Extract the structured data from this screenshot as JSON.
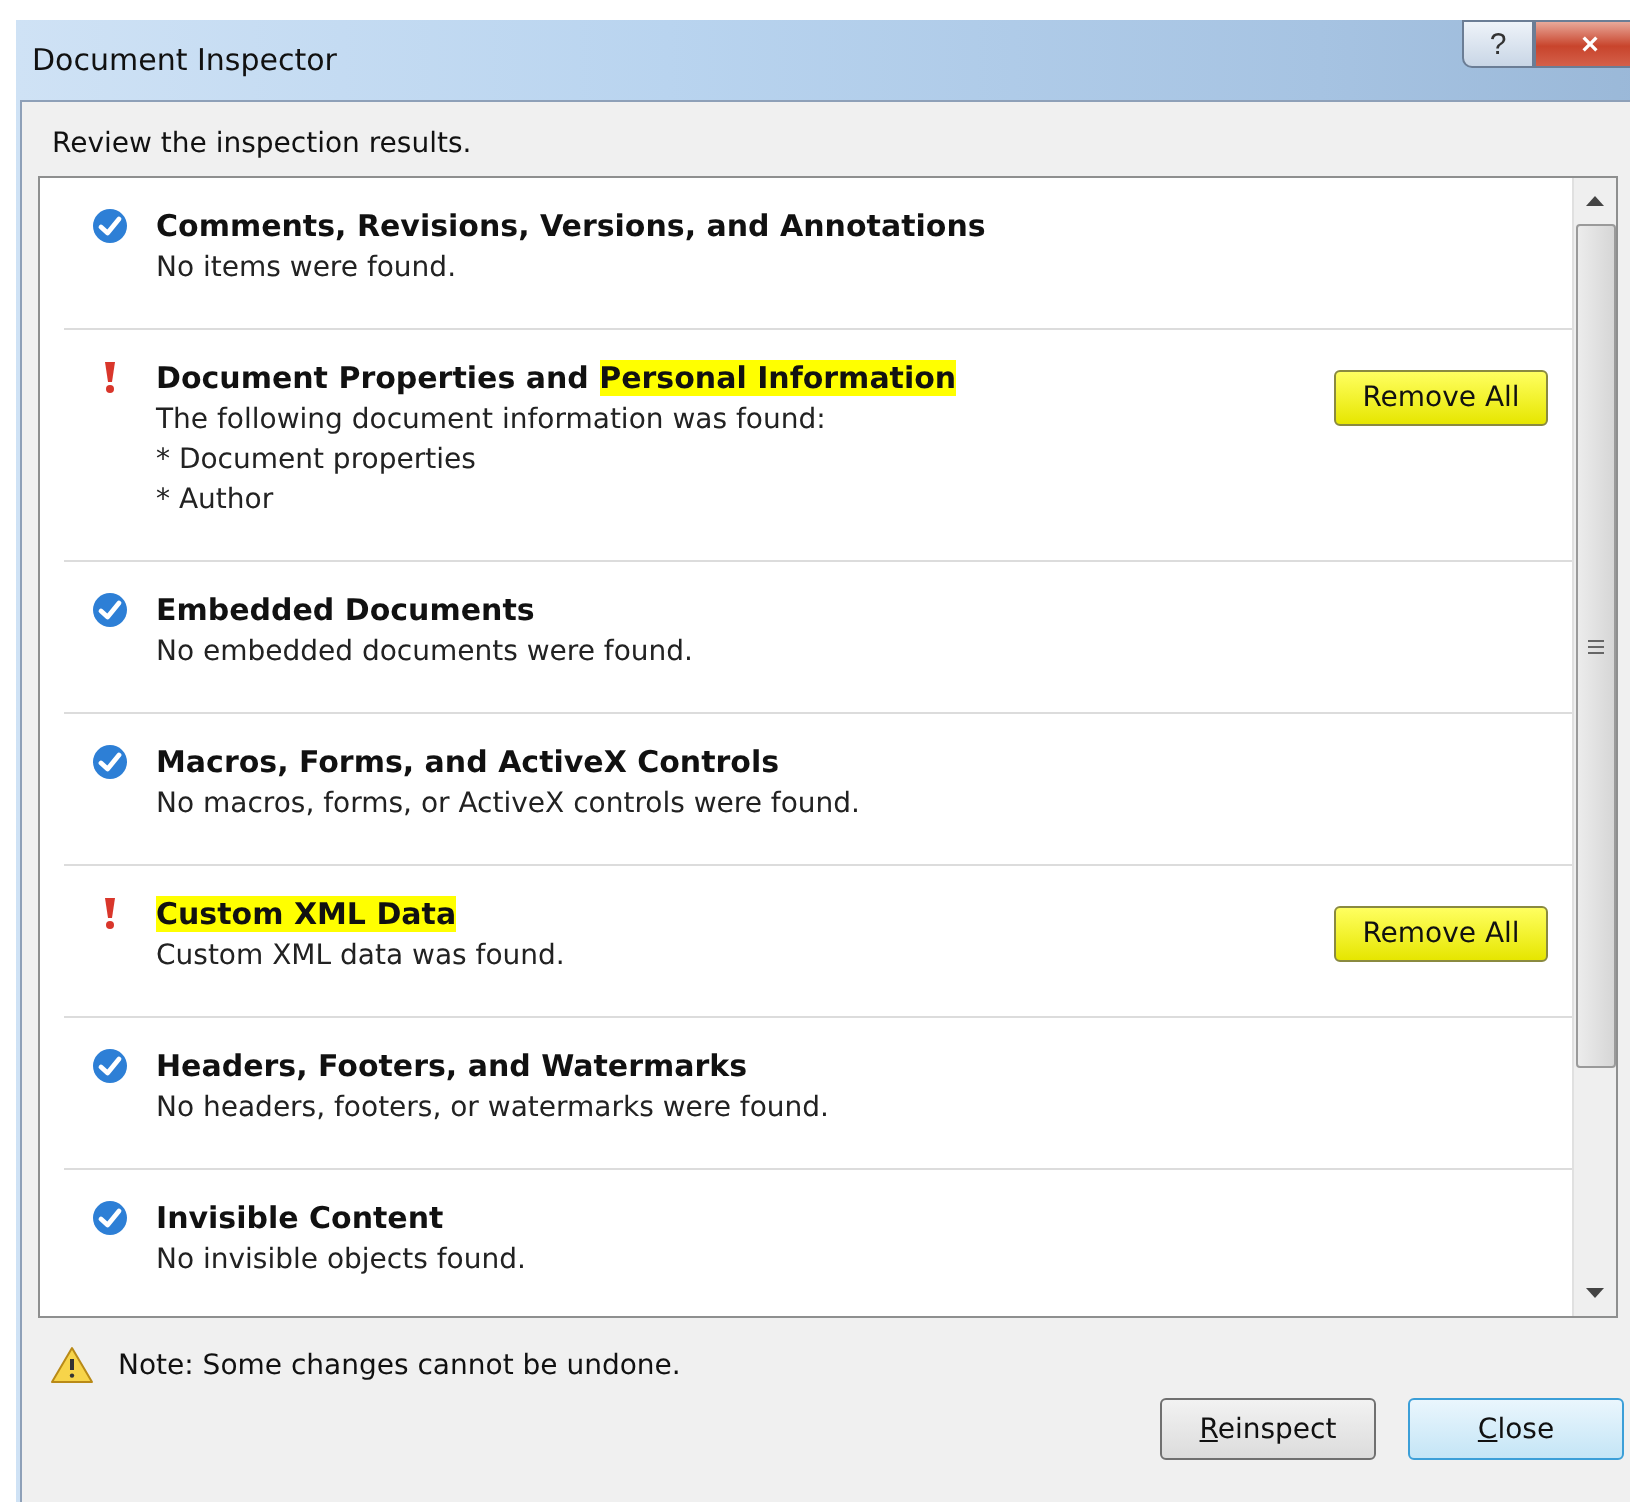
{
  "window": {
    "title": "Document Inspector",
    "help": "?",
    "close": "×"
  },
  "instruction": "Review the inspection results.",
  "results": [
    {
      "kind": "ok",
      "title": [
        {
          "text": "Comments, Revisions, Versions, and Annotations",
          "highlighted": false
        }
      ],
      "lines": [
        "No items were found."
      ]
    },
    {
      "kind": "found",
      "title": [
        {
          "text": "Document Properties and ",
          "highlighted": false
        },
        {
          "text": "Personal Information",
          "highlighted": true
        }
      ],
      "lines": [
        "The following document information was found:",
        "* Document properties",
        "* Author"
      ],
      "button": {
        "label": "Remove All",
        "highlighted": true
      }
    },
    {
      "kind": "ok",
      "title": [
        {
          "text": "Embedded Documents",
          "highlighted": false
        }
      ],
      "lines": [
        "No embedded documents were found."
      ]
    },
    {
      "kind": "ok",
      "title": [
        {
          "text": "Macros, Forms, and ActiveX Controls",
          "highlighted": false
        }
      ],
      "lines": [
        "No macros, forms, or ActiveX controls were found."
      ]
    },
    {
      "kind": "found",
      "title": [
        {
          "text": "Custom XML Data",
          "highlighted": true
        }
      ],
      "lines": [
        "Custom XML data was found."
      ],
      "button": {
        "label": "Remove All",
        "highlighted": true
      }
    },
    {
      "kind": "ok",
      "title": [
        {
          "text": "Headers, Footers, and Watermarks",
          "highlighted": false
        }
      ],
      "lines": [
        "No headers, footers, or watermarks were found."
      ]
    },
    {
      "kind": "ok",
      "title": [
        {
          "text": "Invisible Content",
          "highlighted": false
        }
      ],
      "lines": [
        "No invisible objects found."
      ]
    }
  ],
  "note": "Note: Some changes cannot be undone.",
  "buttons": [
    {
      "access_key": "R",
      "rest": "einspect",
      "default": false
    },
    {
      "access_key": "C",
      "rest": "lose",
      "default": true
    }
  ]
}
